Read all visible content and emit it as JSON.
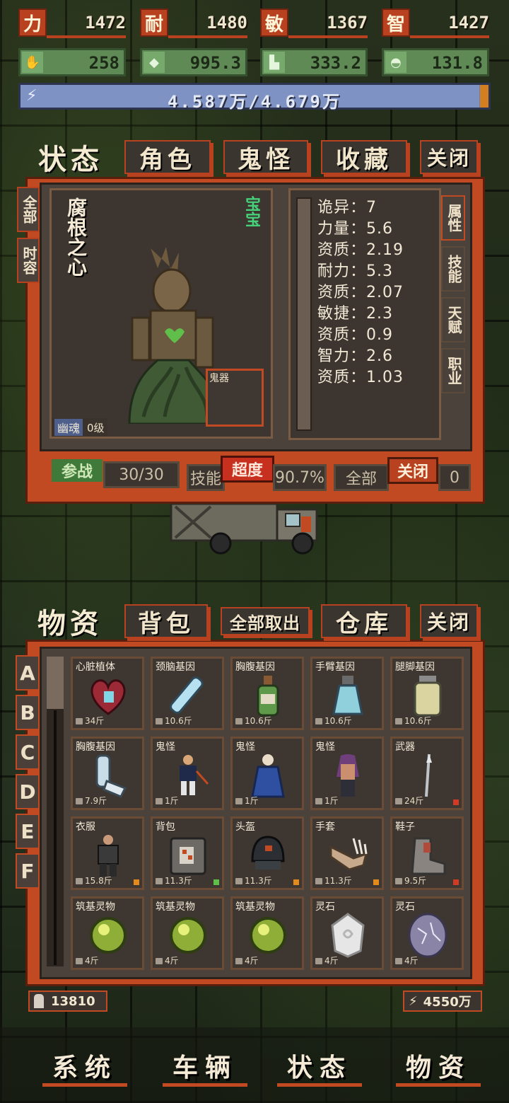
{
  "stats": [
    {
      "label": "力",
      "value": "1472"
    },
    {
      "label": "耐",
      "value": "1480"
    },
    {
      "label": "敏",
      "value": "1367"
    },
    {
      "label": "智",
      "value": "1427"
    }
  ],
  "gear": [
    {
      "icon": "glove-icon",
      "value": "258"
    },
    {
      "icon": "armor-icon",
      "value": "995.3"
    },
    {
      "icon": "boot-icon",
      "value": "333.2"
    },
    {
      "icon": "helmet-icon",
      "value": "131.8"
    }
  ],
  "energy": {
    "text": "4.587万/4.679万",
    "fraction": 0.98,
    "color": "#7f92c4"
  },
  "status_panel": {
    "tabs": [
      "状态",
      "角色",
      "鬼怪",
      "收藏",
      "关闭"
    ],
    "side_tabs": [
      "全部",
      "时容"
    ],
    "right_tabs": [
      "属性",
      "技能",
      "天赋",
      "职业"
    ],
    "card": {
      "name": "腐根之心",
      "badge": "宝宝",
      "slot_label": "鬼器",
      "type": "幽魂",
      "level": "0级"
    },
    "attributes": [
      "诡异：7",
      "力量：5.6",
      "资质：2.19",
      "耐力：5.3",
      "资质：2.07",
      "敏捷：2.3",
      "资质：0.9",
      "智力：2.6",
      "资质：1.03"
    ],
    "footer": {
      "fight": "参战",
      "count": "30/30",
      "skill_label": "技能",
      "overdrive": "超度",
      "percent": "90.7%",
      "all_label": "全部",
      "close": "关闭",
      "tail": "0"
    }
  },
  "inventory_panel": {
    "tabs": [
      "物资",
      "背包",
      "全部取出",
      "仓库",
      "关闭"
    ],
    "letters": [
      "A",
      "B",
      "C",
      "D",
      "E",
      "F"
    ],
    "items": [
      {
        "name": "心脏植体",
        "weight": "34斤",
        "icon": "heart-icon",
        "quality": ""
      },
      {
        "name": "颈脑基因",
        "weight": "10.6斤",
        "icon": "test-tube-icon",
        "quality": ""
      },
      {
        "name": "胸腹基因",
        "weight": "10.6斤",
        "icon": "bottle-icon",
        "quality": ""
      },
      {
        "name": "手臂基因",
        "weight": "10.6斤",
        "icon": "flask-icon",
        "quality": ""
      },
      {
        "name": "腿脚基因",
        "weight": "10.6斤",
        "icon": "jar-icon",
        "quality": ""
      },
      {
        "name": "胸腹基因",
        "weight": "7.9斤",
        "icon": "inhaler-icon",
        "quality": ""
      },
      {
        "name": "鬼怪",
        "weight": "1斤",
        "icon": "fighter-icon",
        "quality": ""
      },
      {
        "name": "鬼怪",
        "weight": "1斤",
        "icon": "robed-ghost-icon",
        "quality": ""
      },
      {
        "name": "鬼怪",
        "weight": "1斤",
        "icon": "long-hair-ghost-icon",
        "quality": ""
      },
      {
        "name": "武器",
        "weight": "24斤",
        "icon": "spear-icon",
        "quality": "#d23a26"
      },
      {
        "name": "衣服",
        "weight": "15.8斤",
        "icon": "armor-suit-icon",
        "quality": "#e38a1d"
      },
      {
        "name": "背包",
        "weight": "11.3斤",
        "icon": "safe-backpack-icon",
        "quality": "#5fbf4a"
      },
      {
        "name": "头盔",
        "weight": "11.3斤",
        "icon": "helmet-icon",
        "quality": "#e38a1d"
      },
      {
        "name": "手套",
        "weight": "11.3斤",
        "icon": "claw-glove-icon",
        "quality": "#e38a1d"
      },
      {
        "name": "鞋子",
        "weight": "9.5斤",
        "icon": "boot-icon",
        "quality": "#d23a26"
      },
      {
        "name": "筑基灵物",
        "weight": "4斤",
        "icon": "green-orb-icon",
        "quality": ""
      },
      {
        "name": "筑基灵物",
        "weight": "4斤",
        "icon": "green-orb-icon",
        "quality": ""
      },
      {
        "name": "筑基灵物",
        "weight": "4斤",
        "icon": "green-orb-icon",
        "quality": ""
      },
      {
        "name": "灵石",
        "weight": "4斤",
        "icon": "white-crystal-icon",
        "quality": ""
      },
      {
        "name": "灵石",
        "weight": "4斤",
        "icon": "purple-stone-icon",
        "quality": ""
      }
    ],
    "footer": {
      "weight": "13810",
      "power": "4550万"
    }
  },
  "bottom_nav": [
    "系统",
    "车辆",
    "状态",
    "物资"
  ]
}
